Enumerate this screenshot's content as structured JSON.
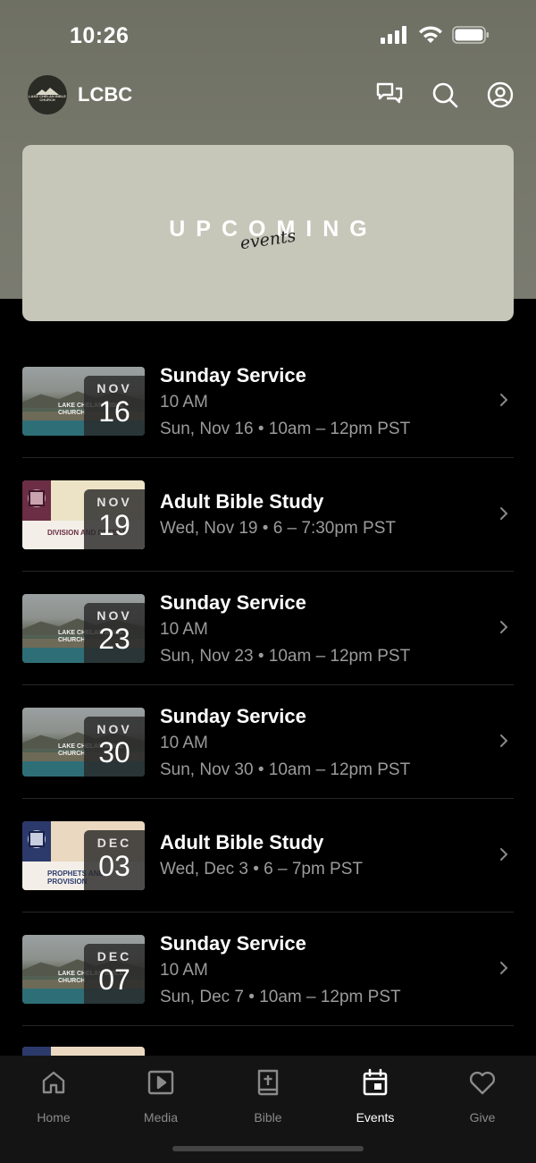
{
  "status_bar": {
    "time": "10:26"
  },
  "app": {
    "name": "LCBC",
    "logo_text": "LAKE CHELAN BIBLE CHURCH"
  },
  "hero": {
    "title": "UPCOMING",
    "script": "events"
  },
  "events": [
    {
      "title": "Sunday Service",
      "subtitle": "10 AM",
      "when": "Sun, Nov 16 • 10am – 12pm PST",
      "month": "NOV",
      "day": "16",
      "thumb": "lake",
      "thumb_text": "LAKE CHELAN BIBLE CHURCH"
    },
    {
      "title": "Adult Bible Study",
      "when": "Wed, Nov 19 • 6 – 7:30pm PST",
      "month": "NOV",
      "day": "19",
      "thumb": "study",
      "thumb_text": "DIVISION AND DEFEAT"
    },
    {
      "title": "Sunday Service",
      "subtitle": "10 AM",
      "when": "Sun, Nov 23 • 10am – 12pm PST",
      "month": "NOV",
      "day": "23",
      "thumb": "lake",
      "thumb_text": "LAKE CHELAN BIBLE CHURCH"
    },
    {
      "title": "Sunday Service",
      "subtitle": "10 AM",
      "when": "Sun, Nov 30 • 10am – 12pm PST",
      "month": "NOV",
      "day": "30",
      "thumb": "lake",
      "thumb_text": "LAKE CHELAN BIBLE CHURCH"
    },
    {
      "title": "Adult Bible Study",
      "when": "Wed, Dec 3 • 6 – 7pm PST",
      "month": "DEC",
      "day": "03",
      "thumb": "study",
      "thumb_text": "PROPHETS AND PROVISION"
    },
    {
      "title": "Sunday Service",
      "subtitle": "10 AM",
      "when": "Sun, Dec 7 • 10am – 12pm PST",
      "month": "DEC",
      "day": "07",
      "thumb": "lake",
      "thumb_text": "LAKE CHELAN BIBLE CHURCH"
    }
  ],
  "tabs": [
    {
      "label": "Home",
      "icon": "home-icon"
    },
    {
      "label": "Media",
      "icon": "media-icon"
    },
    {
      "label": "Bible",
      "icon": "bible-icon"
    },
    {
      "label": "Events",
      "icon": "calendar-icon",
      "active": true
    },
    {
      "label": "Give",
      "icon": "heart-icon"
    }
  ],
  "colors": {
    "header": "#77786c",
    "hero": "#c6c7b9",
    "background": "#000000",
    "muted_text": "#9b9b9b"
  }
}
